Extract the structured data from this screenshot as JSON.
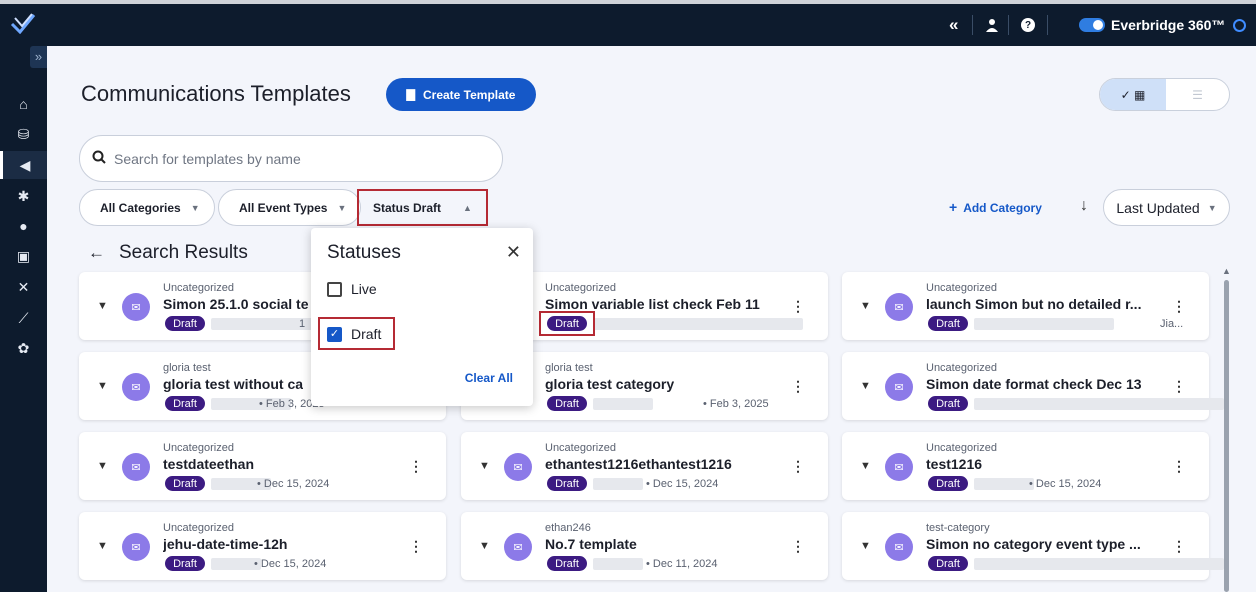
{
  "header": {
    "toggle_label": "Everbridge 360™",
    "collapse_icon": "«"
  },
  "sidebar": {
    "icons": [
      "home-icon",
      "org-icon",
      "broadcast-icon",
      "incident-icon",
      "location-icon",
      "report-icon",
      "scenario-icon",
      "analytics-icon",
      "settings-icon"
    ]
  },
  "page": {
    "title": "Communications Templates",
    "create_label": "Create Template",
    "search_placeholder": "Search for templates by name",
    "filters": [
      "All Categories",
      "All Event Types",
      "Status Draft"
    ],
    "add_category": "Add Category",
    "sort_label": "Last Updated",
    "results_title": "Search Results"
  },
  "status_popup": {
    "title": "Statuses",
    "options": [
      {
        "label": "Live",
        "checked": false
      },
      {
        "label": "Draft",
        "checked": true
      }
    ],
    "clear_all": "Clear All"
  },
  "cards": [
    {
      "category": "Uncategorized",
      "name": "Simon 25.1.0 social te",
      "status": "Draft",
      "date": "1"
    },
    {
      "category": "Uncategorized",
      "name": "Simon variable list check Feb 11",
      "status": "Draft",
      "date": ""
    },
    {
      "category": "Uncategorized",
      "name": "launch Simon but no detailed r...",
      "status": "Draft",
      "date": "Jia..."
    },
    {
      "category": "gloria test",
      "name": "gloria test without ca",
      "status": "Draft",
      "date": "• Feb 3, 2025"
    },
    {
      "category": "gloria test",
      "name": "gloria test category",
      "status": "Draft",
      "date": "• Feb 3, 2025"
    },
    {
      "category": "Uncategorized",
      "name": "Simon date format check Dec 13",
      "status": "Draft",
      "date": ""
    },
    {
      "category": "Uncategorized",
      "name": "testdateethan",
      "status": "Draft",
      "date": "• Dec 15, 2024"
    },
    {
      "category": "Uncategorized",
      "name": "ethantest1216ethantest1216",
      "status": "Draft",
      "date": "• Dec 15, 2024"
    },
    {
      "category": "Uncategorized",
      "name": "test1216",
      "status": "Draft",
      "date": "• Dec 15, 2024"
    },
    {
      "category": "Uncategorized",
      "name": "jehu-date-time-12h",
      "status": "Draft",
      "date": "• Dec 15, 2024"
    },
    {
      "category": "ethan246",
      "name": "No.7 template",
      "status": "Draft",
      "date": "• Dec 11, 2024"
    },
    {
      "category": "test-category",
      "name": "Simon no category event type ...",
      "status": "Draft",
      "date": ""
    }
  ]
}
